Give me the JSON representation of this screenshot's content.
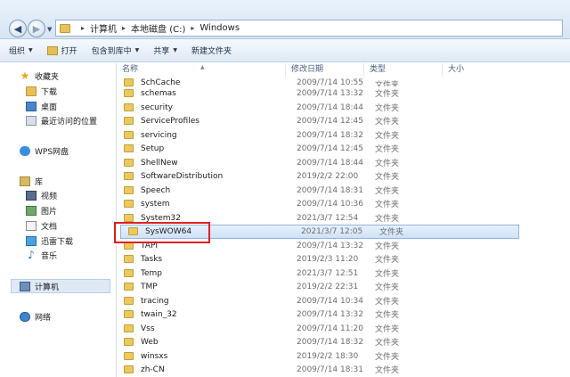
{
  "address": {
    "path": [
      "计算机",
      "本地磁盘 (C:)",
      "Windows"
    ]
  },
  "toolbar": {
    "organize": "组织",
    "open": "打开",
    "include_in_library": "包含到库中",
    "share": "共享",
    "new_folder": "新建文件夹"
  },
  "nav": {
    "favorites": "收藏夹",
    "downloads": "下载",
    "desktop": "桌面",
    "recent": "最近访问的位置",
    "wps": "WPS网盘",
    "libraries": "库",
    "videos": "视频",
    "pictures": "图片",
    "documents": "文档",
    "xunlei": "迅雷下载",
    "music": "音乐",
    "computer": "计算机",
    "network": "网络"
  },
  "columns": {
    "name": "名称",
    "date": "修改日期",
    "type": "类型",
    "size": "大小"
  },
  "files": [
    {
      "name": "SchCache",
      "date": "2009/7/14 10:55",
      "type": "文件夹"
    },
    {
      "name": "schemas",
      "date": "2009/7/14 13:32",
      "type": "文件夹"
    },
    {
      "name": "security",
      "date": "2009/7/14 18:44",
      "type": "文件夹"
    },
    {
      "name": "ServiceProfiles",
      "date": "2009/7/14 12:45",
      "type": "文件夹"
    },
    {
      "name": "servicing",
      "date": "2009/7/14 18:32",
      "type": "文件夹"
    },
    {
      "name": "Setup",
      "date": "2009/7/14 12:45",
      "type": "文件夹"
    },
    {
      "name": "ShellNew",
      "date": "2009/7/14 18:44",
      "type": "文件夹"
    },
    {
      "name": "SoftwareDistribution",
      "date": "2019/2/2 22:00",
      "type": "文件夹"
    },
    {
      "name": "Speech",
      "date": "2009/7/14 18:31",
      "type": "文件夹"
    },
    {
      "name": "system",
      "date": "2009/7/14 10:36",
      "type": "文件夹"
    },
    {
      "name": "System32",
      "date": "2021/3/7 12:54",
      "type": "文件夹"
    },
    {
      "name": "SysWOW64",
      "date": "2021/3/7 12:05",
      "type": "文件夹"
    },
    {
      "name": "TAPI",
      "date": "2009/7/14 13:32",
      "type": "文件夹"
    },
    {
      "name": "Tasks",
      "date": "2019/2/3 11:20",
      "type": "文件夹"
    },
    {
      "name": "Temp",
      "date": "2021/3/7 12:51",
      "type": "文件夹"
    },
    {
      "name": "TMP",
      "date": "2019/2/2 22:31",
      "type": "文件夹"
    },
    {
      "name": "tracing",
      "date": "2009/7/14 10:34",
      "type": "文件夹"
    },
    {
      "name": "twain_32",
      "date": "2009/7/14 13:32",
      "type": "文件夹"
    },
    {
      "name": "Vss",
      "date": "2009/7/14 11:20",
      "type": "文件夹"
    },
    {
      "name": "Web",
      "date": "2009/7/14 18:32",
      "type": "文件夹"
    },
    {
      "name": "winsxs",
      "date": "2019/2/2 18:30",
      "type": "文件夹"
    },
    {
      "name": "zh-CN",
      "date": "2009/7/14 18:31",
      "type": "文件夹"
    }
  ]
}
